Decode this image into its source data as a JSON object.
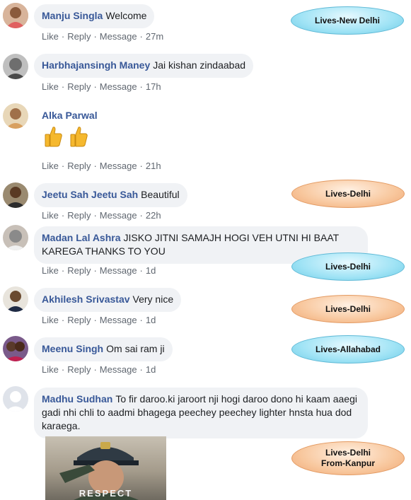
{
  "actions": {
    "like": "Like",
    "reply": "Reply",
    "message": "Message",
    "sep": "·"
  },
  "comments": [
    {
      "author": "Manju Singla",
      "text": "Welcome",
      "time": "27m"
    },
    {
      "author": "Harbhajansingh Maney",
      "text": "Jai kishan zindaabad",
      "time": "17h"
    },
    {
      "author": "Alka Parwal",
      "text": "",
      "time": "21h"
    },
    {
      "author": "Jeetu Sah Jeetu Sah",
      "text": "Beautiful",
      "time": "22h"
    },
    {
      "author": "Madan Lal Ashra",
      "text": "JISKO JITNI SAMAJH HOGI VEH UTNI HI BAAT KAREGA THANKS TO YOU",
      "time": "1d"
    },
    {
      "author": "Akhilesh Srivastav",
      "text": "Very nice",
      "time": "1d"
    },
    {
      "author": "Meenu Singh",
      "text": "Om sai ram ji",
      "time": "1d"
    },
    {
      "author": "Madhu Sudhan",
      "text": "To fir daroo.ki jaroort nji hogi daroo dono hi kaam aaegi gadi nhi chli to aadmi bhagega peechey peechey lighter hnsta hua dod karaega.",
      "time": ""
    }
  ],
  "labels": [
    {
      "text": "Lives-New Delhi",
      "color": "blue"
    },
    {
      "text": "Lives-Delhi",
      "color": "orange"
    },
    {
      "text": "Lives-Delhi",
      "color": "blue"
    },
    {
      "text": "Lives-Delhi",
      "color": "orange"
    },
    {
      "text": "Lives-Allahabad",
      "color": "blue"
    },
    {
      "line1": "Lives-Delhi",
      "line2": "From-Kanpur",
      "color": "orange"
    }
  ],
  "gif": {
    "caption": "RESPECT"
  }
}
